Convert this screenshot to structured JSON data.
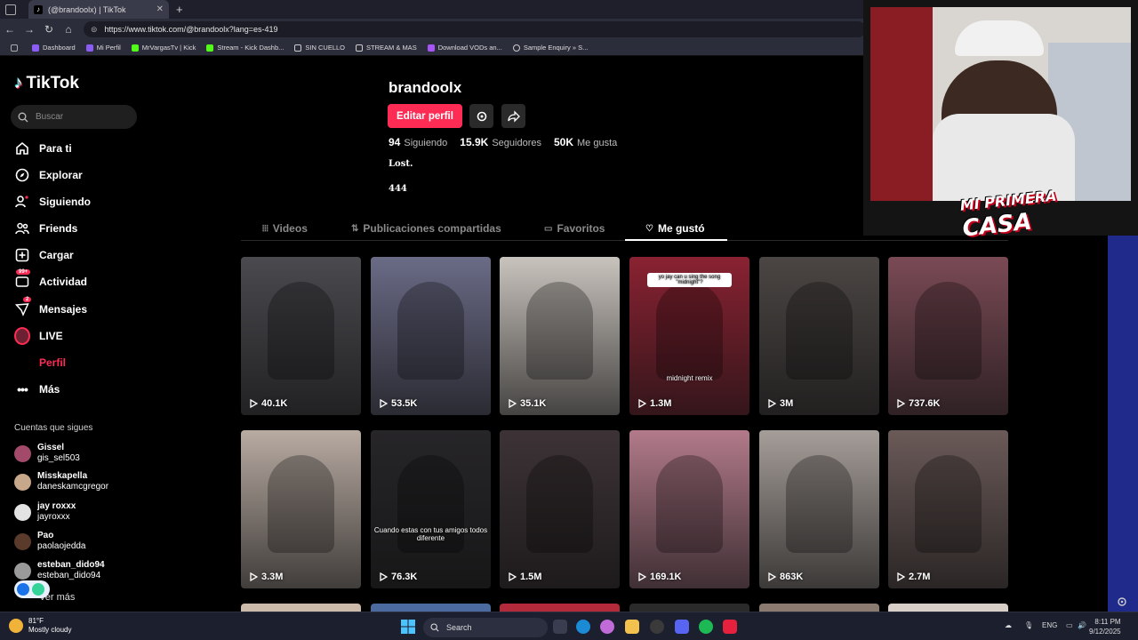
{
  "browser": {
    "tab_title": "(@brandoolx) | TikTok",
    "url": "https://www.tiktok.com/@brandoolx?lang=es-419",
    "bookmarks": [
      "Dashboard",
      "Mi Perfil",
      "MrVargasTv | Kick",
      "Stream - Kick Dashb...",
      "SIN CUELLO",
      "STREAM & MAS",
      "Download VODs an...",
      "Sample Enquiry » S..."
    ]
  },
  "sidebar": {
    "logo": "TikTok",
    "search_placeholder": "Buscar",
    "nav": [
      {
        "label": "Para ti",
        "icon": "home-icon"
      },
      {
        "label": "Explorar",
        "icon": "compass-icon"
      },
      {
        "label": "Siguiendo",
        "icon": "following-icon"
      },
      {
        "label": "Friends",
        "icon": "friends-icon"
      },
      {
        "label": "Cargar",
        "icon": "upload-icon"
      },
      {
        "label": "Actividad",
        "icon": "activity-icon",
        "badge": "99+"
      },
      {
        "label": "Mensajes",
        "icon": "messages-icon",
        "badge": "2"
      },
      {
        "label": "LIVE",
        "icon": "live-icon"
      },
      {
        "label": "Perfil",
        "icon": "profile-icon"
      },
      {
        "label": "Más",
        "icon": "more-icon"
      }
    ],
    "following_title": "Cuentas que sigues",
    "following": [
      {
        "name": "Gissel",
        "handle": "gis_sel503"
      },
      {
        "name": "Misskapella",
        "handle": "daneskamcgregor"
      },
      {
        "name": "jay roxxx",
        "handle": "jayroxxx"
      },
      {
        "name": "Pao",
        "handle": "paolaojedda"
      },
      {
        "name": "esteban_dido94",
        "handle": "esteban_dido94"
      }
    ],
    "see_more": "Ver más"
  },
  "profile": {
    "username": "brandoolx",
    "edit_label": "Editar perfil",
    "following_count": "94",
    "following_label": "Siguiendo",
    "followers_count": "15.9K",
    "followers_label": "Seguidores",
    "likes_count": "50K",
    "likes_label": "Me gusta",
    "bio_line1": "Lost.",
    "bio_line2": "444"
  },
  "tabs": [
    "Videos",
    "Publicaciones compartidas",
    "Favoritos",
    "Me gustó"
  ],
  "videos": [
    {
      "views": "40.1K",
      "color": "#4a4a4f"
    },
    {
      "views": "53.5K",
      "color": "#6a6b86"
    },
    {
      "views": "35.1K",
      "color": "#c9c3bd"
    },
    {
      "views": "1.3M",
      "color": "#8a2232",
      "caption": "midnight remix",
      "caption_top": "yo jay can u sing the song \"midnight\"?"
    },
    {
      "views": "3M",
      "color": "#4b4644"
    },
    {
      "views": "737.6K",
      "color": "#7a4a55"
    },
    {
      "views": "3.3M",
      "color": "#b8aba2"
    },
    {
      "views": "76.3K",
      "color": "#262528",
      "caption": "Cuando estas con tus amigos todos diferente"
    },
    {
      "views": "1.5M",
      "color": "#3d3336"
    },
    {
      "views": "169.1K",
      "color": "#b27a8a"
    },
    {
      "views": "863K",
      "color": "#a59d98"
    },
    {
      "views": "2.7M",
      "color": "#6a5a58"
    }
  ],
  "overlay": {
    "line1": "MI PRIMERA",
    "line2": "CASA"
  },
  "taskbar": {
    "temp": "81°F",
    "weather": "Mostly cloudy",
    "search": "Search",
    "lang": "ENG",
    "time": "8:11 PM",
    "date": "9/12/2025"
  }
}
